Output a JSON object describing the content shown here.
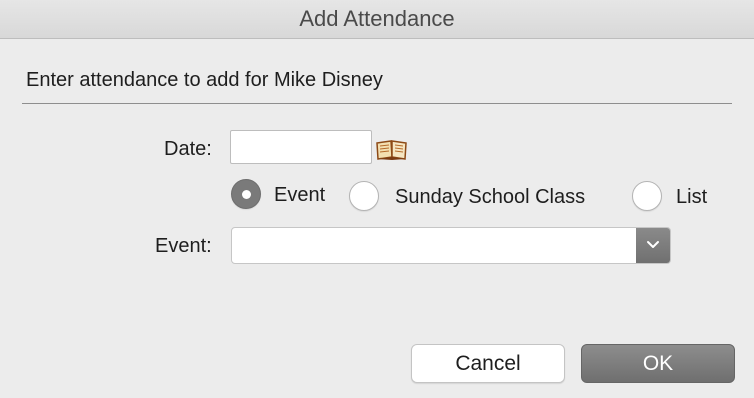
{
  "window": {
    "title": "Add Attendance"
  },
  "form": {
    "instruction": "Enter attendance to add for Mike Disney",
    "date_label": "Date:",
    "date_value": "",
    "calendar_icon": "calendar-book-icon",
    "attendance_type": {
      "options": [
        {
          "label": "Event",
          "selected": true
        },
        {
          "label": "Sunday School Class",
          "selected": false
        },
        {
          "label": "List",
          "selected": false
        }
      ]
    },
    "event_label": "Event:",
    "event_value": "",
    "event_dropdown_icon": "chevron-down-icon"
  },
  "buttons": {
    "cancel_label": "Cancel",
    "ok_label": "OK"
  },
  "colors": {
    "window_bg": "#ececec",
    "selected_radio": "#7a7a7a",
    "default_button": "#7e7e7e"
  }
}
